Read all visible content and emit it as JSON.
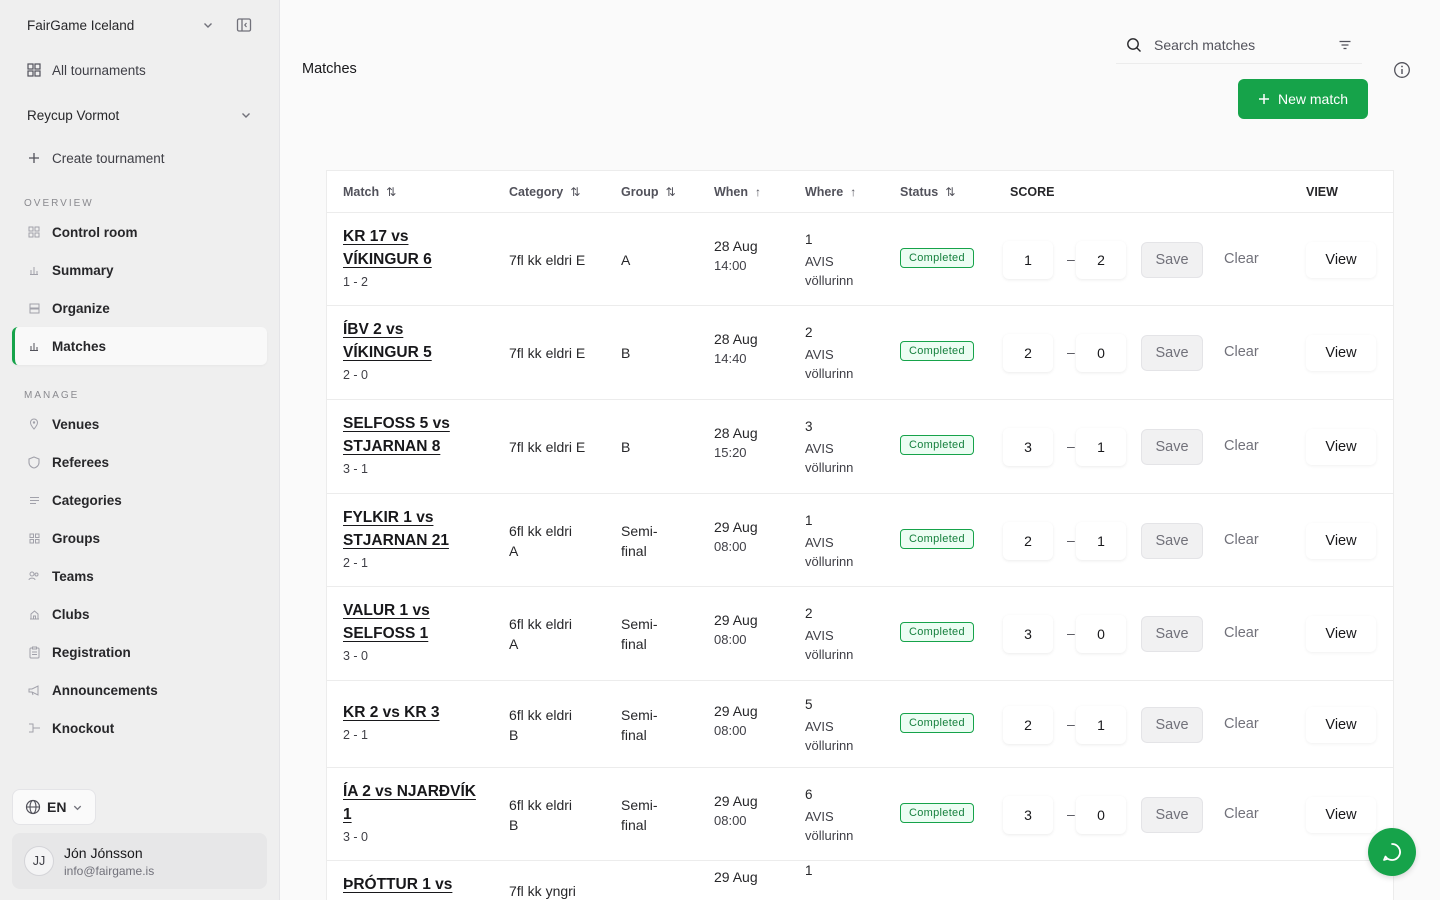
{
  "sidebar": {
    "org_name": "FairGame Iceland",
    "all_tournaments": "All tournaments",
    "tournament": "Reycup Vormot",
    "create_tournament": "Create tournament",
    "overview_label": "OVERVIEW",
    "overview_items": [
      {
        "label": "Control room",
        "icon": "grid-icon",
        "active": false
      },
      {
        "label": "Summary",
        "icon": "bar-chart-icon",
        "active": false
      },
      {
        "label": "Organize",
        "icon": "layout-icon",
        "active": false
      },
      {
        "label": "Matches",
        "icon": "bar-chart-icon",
        "active": true
      }
    ],
    "manage_label": "MANAGE",
    "manage_items": [
      {
        "label": "Venues",
        "icon": "map-pin-icon"
      },
      {
        "label": "Referees",
        "icon": "shield-icon"
      },
      {
        "label": "Categories",
        "icon": "list-icon"
      },
      {
        "label": "Groups",
        "icon": "grid-icon"
      },
      {
        "label": "Teams",
        "icon": "users-icon"
      },
      {
        "label": "Clubs",
        "icon": "building-icon"
      },
      {
        "label": "Registration",
        "icon": "clipboard-icon"
      },
      {
        "label": "Announcements",
        "icon": "megaphone-icon"
      },
      {
        "label": "Knockout",
        "icon": "bracket-icon"
      }
    ],
    "language": "EN",
    "user": {
      "initials": "JJ",
      "name": "Jón Jónsson",
      "email": "info@fairgame.is"
    }
  },
  "header": {
    "title": "Matches",
    "search_placeholder": "Search matches",
    "new_match_label": "New match"
  },
  "table": {
    "columns": {
      "match": "Match",
      "category": "Category",
      "group": "Group",
      "when": "When",
      "where": "Where",
      "status": "Status",
      "score": "SCORE",
      "view": "VIEW"
    },
    "actions": {
      "save": "Save",
      "clear": "Clear",
      "view": "View",
      "dash": "–"
    },
    "rows": [
      {
        "title_l1": "KR 17 vs",
        "title_l2": "VÍKINGUR 6",
        "result": "1 - 2",
        "cat_l1": "7fl kk eldri E",
        "cat_l2": "",
        "grp_l1": "A",
        "grp_l2": "",
        "date": "28 Aug",
        "time": "14:00",
        "pitch": "1",
        "venue_l1": "AVIS",
        "venue_l2": "völlurinn",
        "status": "Completed",
        "home": "1",
        "away": "2"
      },
      {
        "title_l1": "ÍBV 2 vs",
        "title_l2": "VÍKINGUR 5",
        "result": "2 - 0",
        "cat_l1": "7fl kk eldri E",
        "cat_l2": "",
        "grp_l1": "B",
        "grp_l2": "",
        "date": "28 Aug",
        "time": "14:40",
        "pitch": "2",
        "venue_l1": "AVIS",
        "venue_l2": "völlurinn",
        "status": "Completed",
        "home": "2",
        "away": "0"
      },
      {
        "title_l1": "SELFOSS 5 vs",
        "title_l2": "STJARNAN 8",
        "result": "3 - 1",
        "cat_l1": "7fl kk eldri E",
        "cat_l2": "",
        "grp_l1": "B",
        "grp_l2": "",
        "date": "28 Aug",
        "time": "15:20",
        "pitch": "3",
        "venue_l1": "AVIS",
        "venue_l2": "völlurinn",
        "status": "Completed",
        "home": "3",
        "away": "1"
      },
      {
        "title_l1": "FYLKIR 1 vs",
        "title_l2": "STJARNAN 21",
        "result": "2 - 1",
        "cat_l1": "6fl kk eldri",
        "cat_l2": "A",
        "grp_l1": "Semi-",
        "grp_l2": "final",
        "date": "29 Aug",
        "time": "08:00",
        "pitch": "1",
        "venue_l1": "AVIS",
        "venue_l2": "völlurinn",
        "status": "Completed",
        "home": "2",
        "away": "1"
      },
      {
        "title_l1": "VALUR 1 vs",
        "title_l2": "SELFOSS 1",
        "result": "3 - 0",
        "cat_l1": "6fl kk eldri",
        "cat_l2": "A",
        "grp_l1": "Semi-",
        "grp_l2": "final",
        "date": "29 Aug",
        "time": "08:00",
        "pitch": "2",
        "venue_l1": "AVIS",
        "venue_l2": "völlurinn",
        "status": "Completed",
        "home": "3",
        "away": "0"
      },
      {
        "title_l1": "KR 2 vs KR 3",
        "title_l2": "",
        "result": "2 - 1",
        "cat_l1": "6fl kk eldri",
        "cat_l2": "B",
        "grp_l1": "Semi-",
        "grp_l2": "final",
        "date": "29 Aug",
        "time": "08:00",
        "pitch": "5",
        "venue_l1": "AVIS",
        "venue_l2": "völlurinn",
        "status": "Completed",
        "home": "2",
        "away": "1"
      },
      {
        "title_l1": "ÍA 2 vs NJARÐVÍK",
        "title_l2": "1",
        "result": "3 - 0",
        "cat_l1": "6fl kk eldri",
        "cat_l2": "B",
        "grp_l1": "Semi-",
        "grp_l2": "final",
        "date": "29 Aug",
        "time": "08:00",
        "pitch": "6",
        "venue_l1": "AVIS",
        "venue_l2": "völlurinn",
        "status": "Completed",
        "home": "3",
        "away": "0"
      },
      {
        "title_l1": "ÞRÓTTUR 1 vs",
        "title_l2": "",
        "result": "",
        "cat_l1": "7fl kk yngri",
        "cat_l2": "",
        "grp_l1": "",
        "grp_l2": "",
        "date": "29 Aug",
        "time": "",
        "pitch": "1",
        "venue_l1": "",
        "venue_l2": "",
        "status": "",
        "home": "",
        "away": ""
      }
    ]
  }
}
